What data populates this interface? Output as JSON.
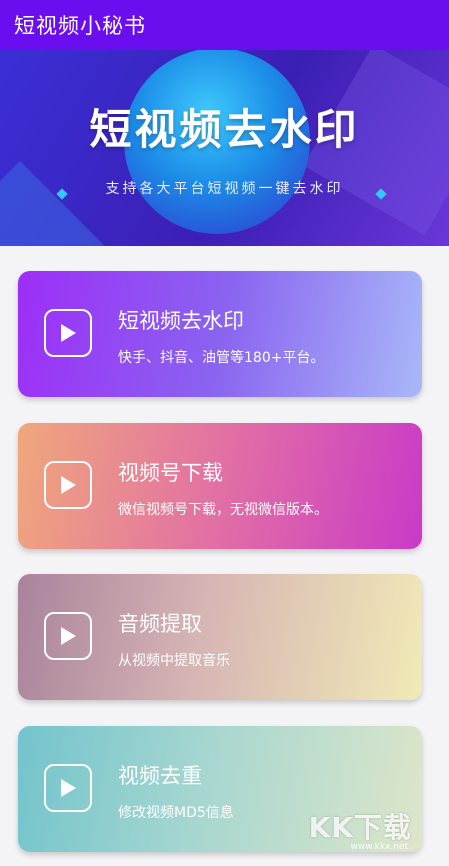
{
  "app_bar": {
    "title": "短视频小秘书"
  },
  "banner": {
    "title": "短视频去水印",
    "subtitle": "支持各大平台短视频一键去水印"
  },
  "cards": [
    {
      "title": "短视频去水印",
      "description": "快手、抖音、油管等180+平台。",
      "icon": "play-icon"
    },
    {
      "title": "视频号下载",
      "description": "微信视频号下载，无视微信版本。",
      "icon": "play-icon"
    },
    {
      "title": "音频提取",
      "description": "从视频中提取音乐",
      "icon": "play-icon"
    },
    {
      "title": "视频去重",
      "description": "修改视频MD5信息",
      "icon": "play-icon"
    }
  ],
  "watermark": {
    "text": "KK下载",
    "url": "www.kkx.net"
  },
  "colors": {
    "app_bar": "#6a0ef0",
    "banner": "#3b1fb4"
  }
}
